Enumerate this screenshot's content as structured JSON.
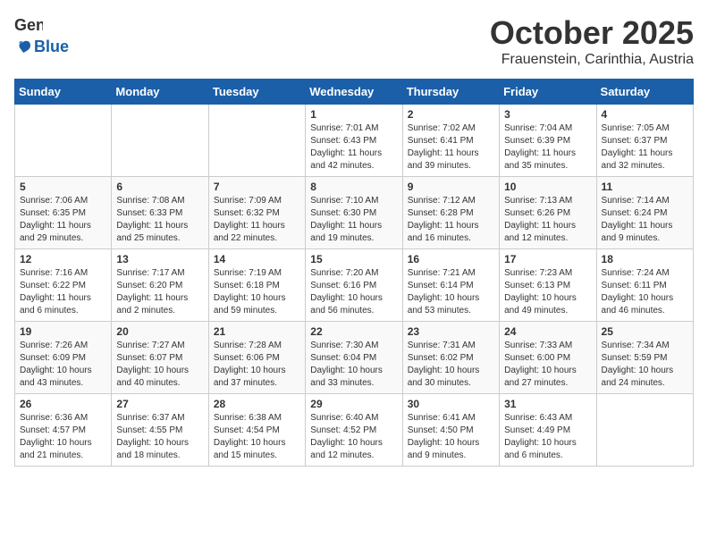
{
  "header": {
    "logo_general": "General",
    "logo_blue": "Blue",
    "month": "October 2025",
    "location": "Frauenstein, Carinthia, Austria"
  },
  "weekdays": [
    "Sunday",
    "Monday",
    "Tuesday",
    "Wednesday",
    "Thursday",
    "Friday",
    "Saturday"
  ],
  "weeks": [
    [
      {
        "day": "",
        "info": ""
      },
      {
        "day": "",
        "info": ""
      },
      {
        "day": "",
        "info": ""
      },
      {
        "day": "1",
        "info": "Sunrise: 7:01 AM\nSunset: 6:43 PM\nDaylight: 11 hours\nand 42 minutes."
      },
      {
        "day": "2",
        "info": "Sunrise: 7:02 AM\nSunset: 6:41 PM\nDaylight: 11 hours\nand 39 minutes."
      },
      {
        "day": "3",
        "info": "Sunrise: 7:04 AM\nSunset: 6:39 PM\nDaylight: 11 hours\nand 35 minutes."
      },
      {
        "day": "4",
        "info": "Sunrise: 7:05 AM\nSunset: 6:37 PM\nDaylight: 11 hours\nand 32 minutes."
      }
    ],
    [
      {
        "day": "5",
        "info": "Sunrise: 7:06 AM\nSunset: 6:35 PM\nDaylight: 11 hours\nand 29 minutes."
      },
      {
        "day": "6",
        "info": "Sunrise: 7:08 AM\nSunset: 6:33 PM\nDaylight: 11 hours\nand 25 minutes."
      },
      {
        "day": "7",
        "info": "Sunrise: 7:09 AM\nSunset: 6:32 PM\nDaylight: 11 hours\nand 22 minutes."
      },
      {
        "day": "8",
        "info": "Sunrise: 7:10 AM\nSunset: 6:30 PM\nDaylight: 11 hours\nand 19 minutes."
      },
      {
        "day": "9",
        "info": "Sunrise: 7:12 AM\nSunset: 6:28 PM\nDaylight: 11 hours\nand 16 minutes."
      },
      {
        "day": "10",
        "info": "Sunrise: 7:13 AM\nSunset: 6:26 PM\nDaylight: 11 hours\nand 12 minutes."
      },
      {
        "day": "11",
        "info": "Sunrise: 7:14 AM\nSunset: 6:24 PM\nDaylight: 11 hours\nand 9 minutes."
      }
    ],
    [
      {
        "day": "12",
        "info": "Sunrise: 7:16 AM\nSunset: 6:22 PM\nDaylight: 11 hours\nand 6 minutes."
      },
      {
        "day": "13",
        "info": "Sunrise: 7:17 AM\nSunset: 6:20 PM\nDaylight: 11 hours\nand 2 minutes."
      },
      {
        "day": "14",
        "info": "Sunrise: 7:19 AM\nSunset: 6:18 PM\nDaylight: 10 hours\nand 59 minutes."
      },
      {
        "day": "15",
        "info": "Sunrise: 7:20 AM\nSunset: 6:16 PM\nDaylight: 10 hours\nand 56 minutes."
      },
      {
        "day": "16",
        "info": "Sunrise: 7:21 AM\nSunset: 6:14 PM\nDaylight: 10 hours\nand 53 minutes."
      },
      {
        "day": "17",
        "info": "Sunrise: 7:23 AM\nSunset: 6:13 PM\nDaylight: 10 hours\nand 49 minutes."
      },
      {
        "day": "18",
        "info": "Sunrise: 7:24 AM\nSunset: 6:11 PM\nDaylight: 10 hours\nand 46 minutes."
      }
    ],
    [
      {
        "day": "19",
        "info": "Sunrise: 7:26 AM\nSunset: 6:09 PM\nDaylight: 10 hours\nand 43 minutes."
      },
      {
        "day": "20",
        "info": "Sunrise: 7:27 AM\nSunset: 6:07 PM\nDaylight: 10 hours\nand 40 minutes."
      },
      {
        "day": "21",
        "info": "Sunrise: 7:28 AM\nSunset: 6:06 PM\nDaylight: 10 hours\nand 37 minutes."
      },
      {
        "day": "22",
        "info": "Sunrise: 7:30 AM\nSunset: 6:04 PM\nDaylight: 10 hours\nand 33 minutes."
      },
      {
        "day": "23",
        "info": "Sunrise: 7:31 AM\nSunset: 6:02 PM\nDaylight: 10 hours\nand 30 minutes."
      },
      {
        "day": "24",
        "info": "Sunrise: 7:33 AM\nSunset: 6:00 PM\nDaylight: 10 hours\nand 27 minutes."
      },
      {
        "day": "25",
        "info": "Sunrise: 7:34 AM\nSunset: 5:59 PM\nDaylight: 10 hours\nand 24 minutes."
      }
    ],
    [
      {
        "day": "26",
        "info": "Sunrise: 6:36 AM\nSunset: 4:57 PM\nDaylight: 10 hours\nand 21 minutes."
      },
      {
        "day": "27",
        "info": "Sunrise: 6:37 AM\nSunset: 4:55 PM\nDaylight: 10 hours\nand 18 minutes."
      },
      {
        "day": "28",
        "info": "Sunrise: 6:38 AM\nSunset: 4:54 PM\nDaylight: 10 hours\nand 15 minutes."
      },
      {
        "day": "29",
        "info": "Sunrise: 6:40 AM\nSunset: 4:52 PM\nDaylight: 10 hours\nand 12 minutes."
      },
      {
        "day": "30",
        "info": "Sunrise: 6:41 AM\nSunset: 4:50 PM\nDaylight: 10 hours\nand 9 minutes."
      },
      {
        "day": "31",
        "info": "Sunrise: 6:43 AM\nSunset: 4:49 PM\nDaylight: 10 hours\nand 6 minutes."
      },
      {
        "day": "",
        "info": ""
      }
    ]
  ]
}
